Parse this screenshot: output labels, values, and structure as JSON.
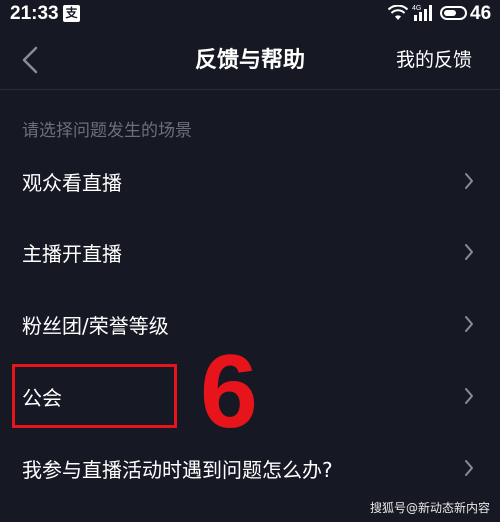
{
  "status_bar": {
    "time": "21:33",
    "app_icon_text": "支",
    "network_label": "4G",
    "battery": "46"
  },
  "header": {
    "title": "反馈与帮助",
    "right_link": "我的反馈"
  },
  "section": {
    "label": "请选择问题发生的场景"
  },
  "menu_items": [
    {
      "label": "观众看直播"
    },
    {
      "label": "主播开直播"
    },
    {
      "label": "粉丝团/荣誉等级"
    },
    {
      "label": "公会"
    },
    {
      "label": "我参与直播活动时遇到问题怎么办?"
    }
  ],
  "annotation": {
    "number": "6"
  },
  "watermark": "搜狐号@新动态新内容",
  "colors": {
    "background": "#161823",
    "highlight": "#e8141b",
    "secondary_text": "#6c6e78"
  }
}
